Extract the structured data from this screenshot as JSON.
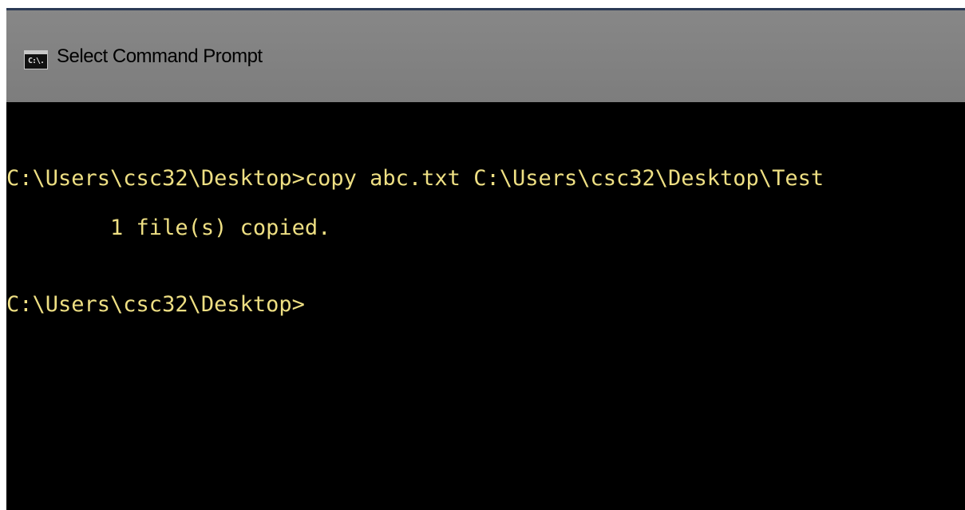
{
  "window": {
    "title": "Select Command Prompt",
    "icon": "cmd-icon",
    "icon_text": "C:\\."
  },
  "console": {
    "text_color": "#eedf83",
    "background": "#000000",
    "lines": [
      "C:\\Users\\csc32\\Desktop>copy abc.txt C:\\Users\\csc32\\Desktop\\Test",
      "        1 file(s) copied.",
      "C:\\Users\\csc32\\Desktop>"
    ]
  }
}
